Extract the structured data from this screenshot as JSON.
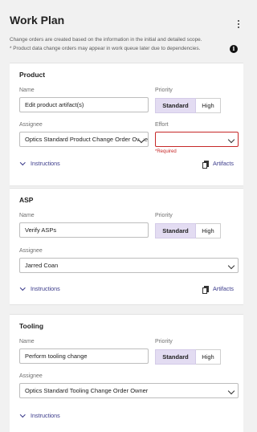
{
  "page": {
    "title": "Work Plan",
    "description_line1": "Change orders are created based on the information in the initial and detailed scope.",
    "description_line2": "* Product data change orders may appear in work queue later due to dependencies.",
    "info_icon_text": "i"
  },
  "labels": {
    "name": "Name",
    "priority": "Priority",
    "assignee": "Assignee",
    "effort": "Effort",
    "required": "*Required",
    "standard": "Standard",
    "high": "High",
    "instructions": "Instructions",
    "artifacts": "Artifacts"
  },
  "cards": [
    {
      "title": "Product",
      "name_value": "Edit product artifact(s)",
      "priority_selected": "Standard",
      "assignee_value": "Optics Standard Product Change Order Owner",
      "effort_value": ""
    },
    {
      "title": "ASP",
      "name_value": "Verify ASPs",
      "priority_selected": "Standard",
      "assignee_value": "Jarred Coan"
    },
    {
      "title": "Tooling",
      "name_value": "Perform tooling change",
      "priority_selected": "Standard",
      "assignee_value": "Optics Standard Tooling Change Order Owner"
    }
  ],
  "icons": {
    "kebab": "more-vertical-icon",
    "info": "info-icon",
    "chevron": "chevron-down-icon",
    "artifacts": "documents-icon"
  },
  "colors": {
    "active_segment": "#e3dcf2",
    "link": "#3a3a8a",
    "error": "#c62828"
  }
}
